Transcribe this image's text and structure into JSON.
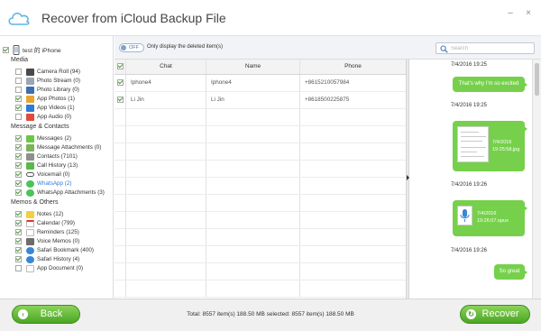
{
  "window": {
    "title": "Recover from iCloud Backup File",
    "controls": [
      "–",
      "×"
    ]
  },
  "sidebar": {
    "device": {
      "label": "test 的 iPhone",
      "checked": true
    },
    "categories": [
      {
        "title": "Media",
        "items": [
          {
            "label": "Camera Roll (94)",
            "icon": "camera-roll-icon",
            "color": "#4a4a4a",
            "checked": false
          },
          {
            "label": "Photo Stream (0)",
            "icon": "photo-stream-icon",
            "color": "#9aa6b3",
            "checked": false
          },
          {
            "label": "Photo Library (0)",
            "icon": "photo-library-icon",
            "color": "#3b6fb0",
            "checked": false
          },
          {
            "label": "App Photos (1)",
            "icon": "app-photos-icon",
            "color": "#e8a532",
            "checked": true
          },
          {
            "label": "App Videos (1)",
            "icon": "app-videos-icon",
            "color": "#2d7bd6",
            "checked": true
          },
          {
            "label": "App Audio (0)",
            "icon": "app-audio-icon",
            "color": "#e24b3b",
            "checked": false
          }
        ]
      },
      {
        "title": "Message & Contacts",
        "items": [
          {
            "label": "Messages (2)",
            "icon": "messages-icon",
            "color": "#6cc644",
            "checked": true
          },
          {
            "label": "Message Attachments (0)",
            "icon": "message-attachments-icon",
            "color": "#7cb35b",
            "checked": true
          },
          {
            "label": "Contacts (7101)",
            "icon": "contacts-icon",
            "color": "#8f8f8f",
            "checked": true
          },
          {
            "label": "Call History (13)",
            "icon": "call-history-icon",
            "color": "#5bb84a",
            "checked": true
          },
          {
            "label": "Voicemail (0)",
            "icon": "voicemail-icon",
            "color": "#555555",
            "checked": true
          },
          {
            "label": "WhatsApp (2)",
            "icon": "whatsapp-icon",
            "color": "#4cc35a",
            "checked": true,
            "selected": true
          },
          {
            "label": "WhatsApp Attachments (3)",
            "icon": "whatsapp-attachments-icon",
            "color": "#4cc35a",
            "checked": true
          }
        ]
      },
      {
        "title": "Memos & Others",
        "items": [
          {
            "label": "Notes (12)",
            "icon": "notes-icon",
            "color": "#f2d045",
            "checked": true
          },
          {
            "label": "Calendar (799)",
            "icon": "calendar-icon",
            "color": "#d9d9d9",
            "checked": true
          },
          {
            "label": "Reminders (125)",
            "icon": "reminders-icon",
            "color": "#e6e6e6",
            "checked": true
          },
          {
            "label": "Voice Memos (0)",
            "icon": "voice-memos-icon",
            "color": "#6d6d6d",
            "checked": true
          },
          {
            "label": "Safari Bookmark (400)",
            "icon": "safari-bookmark-icon",
            "color": "#3a86d6",
            "checked": true
          },
          {
            "label": "Safari History (4)",
            "icon": "safari-history-icon",
            "color": "#3a86d6",
            "checked": true
          },
          {
            "label": "App Document (0)",
            "icon": "app-document-icon",
            "color": "#d9d9d9",
            "checked": false
          }
        ]
      }
    ]
  },
  "toolbar": {
    "toggle_text": "OFF",
    "toggle_label": "Only display the deleted item(s)",
    "search_placeholder": "Search"
  },
  "table": {
    "headers": [
      "Chat",
      "Name",
      "Phone"
    ],
    "rows": [
      {
        "chat": "Iphone4",
        "name": "Iphone4",
        "phone": "+8615210057984",
        "checked": true
      },
      {
        "chat": "Li Jin",
        "name": "Li Jin",
        "phone": "+8618500225875",
        "checked": true
      }
    ],
    "empty_rows": 11
  },
  "chat": {
    "messages": [
      {
        "time": "7/4/2016 19:25",
        "type": "text",
        "text": "That's why I'm so excited"
      },
      {
        "time": "7/4/2016 19:25",
        "type": "image",
        "caption": [
          "7/4/2016",
          "19:25:58.jpg"
        ]
      },
      {
        "time": "7/4/2016 19:26",
        "type": "audio",
        "caption": [
          "7/4/2016",
          "19:26:07.opus"
        ]
      },
      {
        "time": "7/4/2016 19:26",
        "type": "text",
        "text": "So great"
      }
    ]
  },
  "footer": {
    "back_label": "Back",
    "recover_label": "Recover",
    "stats": "Total: 8557 item(s) 188.50 MB   selected: 8557 item(s) 188.50 MB"
  },
  "colors": {
    "accent": "#4aa623",
    "bubble": "#76d04b",
    "selected_text": "#2f7ad9"
  }
}
